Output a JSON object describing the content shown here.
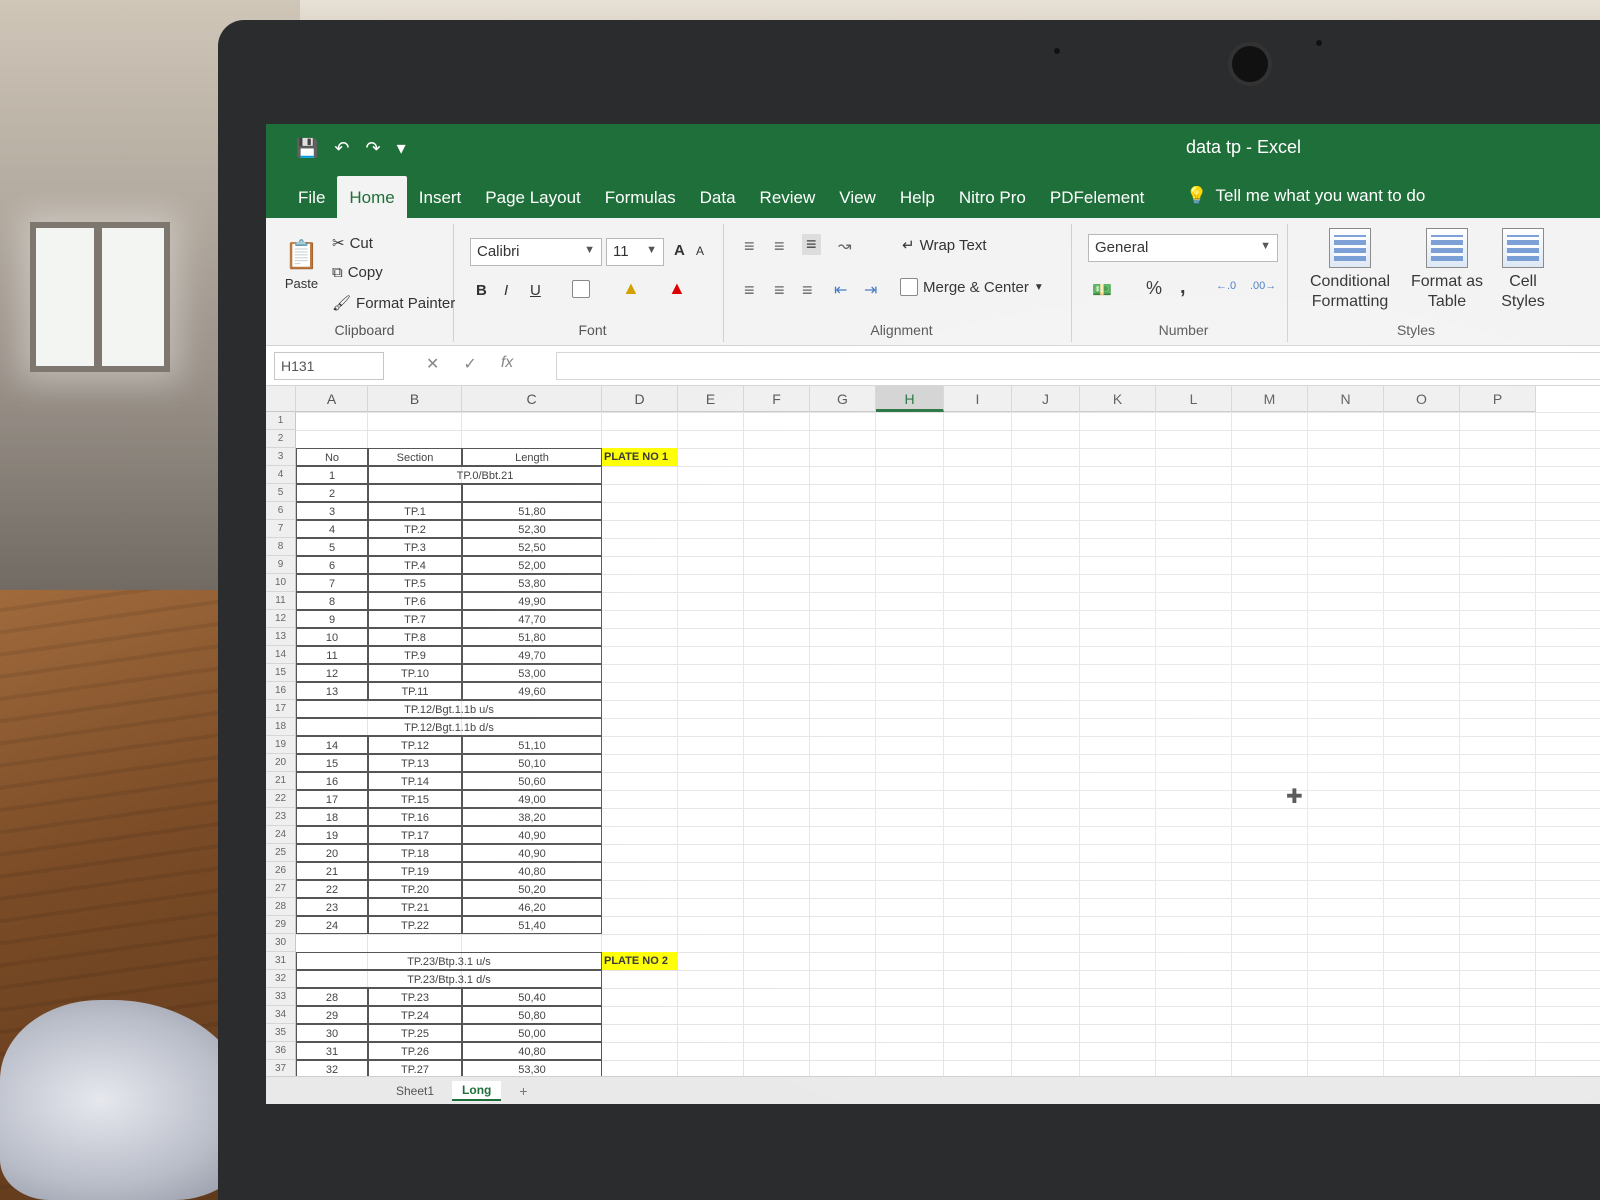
{
  "window": {
    "title": "data tp  -  Excel"
  },
  "tabs": [
    "File",
    "Home",
    "Insert",
    "Page Layout",
    "Formulas",
    "Data",
    "Review",
    "View",
    "Help",
    "Nitro Pro",
    "PDFelement"
  ],
  "tell_me": "Tell me what you want to do",
  "clipboard": {
    "paste": "Paste",
    "cut": "Cut",
    "copy": "Copy",
    "format_painter": "Format Painter",
    "label": "Clipboard"
  },
  "font": {
    "name": "Calibri",
    "size": "11",
    "bold": "B",
    "italic": "I",
    "underline": "U",
    "grow": "A",
    "shrink": "A",
    "label": "Font"
  },
  "alignment": {
    "wrap": "Wrap Text",
    "merge": "Merge & Center",
    "label": "Alignment"
  },
  "number": {
    "format": "General",
    "percent": "%",
    "comma": ",",
    "label": "Number"
  },
  "styles": {
    "conditional": "Conditional Formatting",
    "format_table": "Format as Table",
    "cell_styles": "Cell Styles",
    "label": "Styles"
  },
  "formula_bar": {
    "name_box": "H131",
    "fx": "fx"
  },
  "columns": [
    "A",
    "B",
    "C",
    "D",
    "E",
    "F",
    "G",
    "H",
    "I",
    "J",
    "K",
    "L",
    "M",
    "N",
    "O",
    "P"
  ],
  "rows": [
    "1",
    "2",
    "3",
    "4",
    "5",
    "6",
    "7",
    "8",
    "9",
    "10",
    "11",
    "12",
    "13",
    "14",
    "15",
    "16",
    "17",
    "18",
    "19",
    "20",
    "21",
    "22",
    "23",
    "24",
    "25",
    "26",
    "27",
    "28",
    "29",
    "30",
    "31",
    "32",
    "33",
    "34",
    "35",
    "36",
    "37"
  ],
  "sheet": {
    "headers": {
      "no": "No",
      "section": "Section",
      "length": "Length"
    },
    "plate1": "PLATE NO 1",
    "plate2": "PLATE NO 2",
    "group1": "TP.0/Bbt.21",
    "group2a": "TP.12/Bgt.1.1b u/s",
    "group2b": "TP.12/Bgt.1.1b d/s",
    "group3a": "TP.23/Btp.3.1 u/s",
    "group3b": "TP.23/Btp.3.1 d/s",
    "data": [
      {
        "no": "1",
        "section": "",
        "length": ""
      },
      {
        "no": "2",
        "section": "",
        "length": ""
      },
      {
        "no": "3",
        "section": "TP.1",
        "length": "51,80"
      },
      {
        "no": "4",
        "section": "TP.2",
        "length": "52,30"
      },
      {
        "no": "5",
        "section": "TP.3",
        "length": "52,50"
      },
      {
        "no": "6",
        "section": "TP.4",
        "length": "52,00"
      },
      {
        "no": "7",
        "section": "TP.5",
        "length": "53,80"
      },
      {
        "no": "8",
        "section": "TP.6",
        "length": "49,90"
      },
      {
        "no": "9",
        "section": "TP.7",
        "length": "47,70"
      },
      {
        "no": "10",
        "section": "TP.8",
        "length": "51,80"
      },
      {
        "no": "11",
        "section": "TP.9",
        "length": "49,70"
      },
      {
        "no": "12",
        "section": "TP.10",
        "length": "53,00"
      },
      {
        "no": "13",
        "section": "TP.11",
        "length": "49,60"
      }
    ],
    "data2": [
      {
        "no": "14",
        "section": "TP.12",
        "length": "51,10"
      },
      {
        "no": "15",
        "section": "TP.13",
        "length": "50,10"
      },
      {
        "no": "16",
        "section": "TP.14",
        "length": "50,60"
      },
      {
        "no": "17",
        "section": "TP.15",
        "length": "49,00"
      },
      {
        "no": "18",
        "section": "TP.16",
        "length": "38,20"
      },
      {
        "no": "19",
        "section": "TP.17",
        "length": "40,90"
      },
      {
        "no": "20",
        "section": "TP.18",
        "length": "40,90"
      },
      {
        "no": "21",
        "section": "TP.19",
        "length": "40,80"
      },
      {
        "no": "22",
        "section": "TP.20",
        "length": "50,20"
      },
      {
        "no": "23",
        "section": "TP.21",
        "length": "46,20"
      },
      {
        "no": "24",
        "section": "TP.22",
        "length": "51,40"
      }
    ],
    "data3": [
      {
        "no": "28",
        "section": "TP.23",
        "length": "50,40"
      },
      {
        "no": "29",
        "section": "TP.24",
        "length": "50,80"
      },
      {
        "no": "30",
        "section": "TP.25",
        "length": "50,00"
      },
      {
        "no": "31",
        "section": "TP.26",
        "length": "40,80"
      },
      {
        "no": "32",
        "section": "TP.27",
        "length": "53,30"
      }
    ]
  },
  "sheet_tabs": [
    "Sheet1",
    "Long"
  ],
  "sheet_add": "+"
}
